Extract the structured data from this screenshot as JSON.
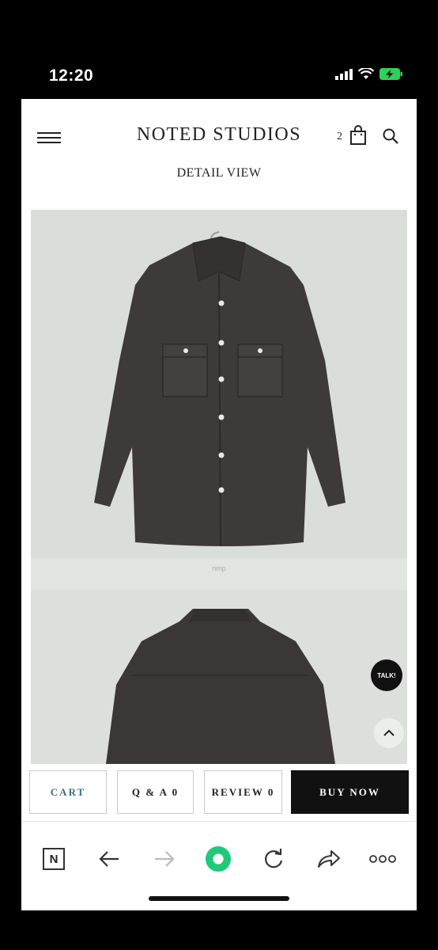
{
  "status_bar": {
    "time": "12:20",
    "icons": [
      "signal-icon",
      "wifi-icon",
      "battery-charging-icon"
    ],
    "battery_color": "#30d158"
  },
  "header": {
    "brand": "NOTED STUDIOS",
    "cart_count": "2",
    "subtitle": "DETAIL VIEW",
    "icons": [
      "menu-icon",
      "shopping-bag-icon",
      "search-icon"
    ]
  },
  "product_image": {
    "caption": "nmp",
    "description_icon": "product-photo"
  },
  "floating": {
    "talk_label": "TALK!",
    "scroll_top_icon": "chevron-up-icon"
  },
  "actions": {
    "cart": "CART",
    "qa": "Q & A 0",
    "review": "REVIEW 0",
    "buy_now": "BUY NOW",
    "cart_color": "#3a6f86"
  },
  "browser_toolbar": {
    "naver_label": "N",
    "icons": [
      "naver-icon",
      "back-arrow-icon",
      "forward-arrow-icon",
      "green-dot-icon",
      "reload-icon",
      "share-icon",
      "more-icon"
    ],
    "green_dot_color": "#1ec97a"
  }
}
